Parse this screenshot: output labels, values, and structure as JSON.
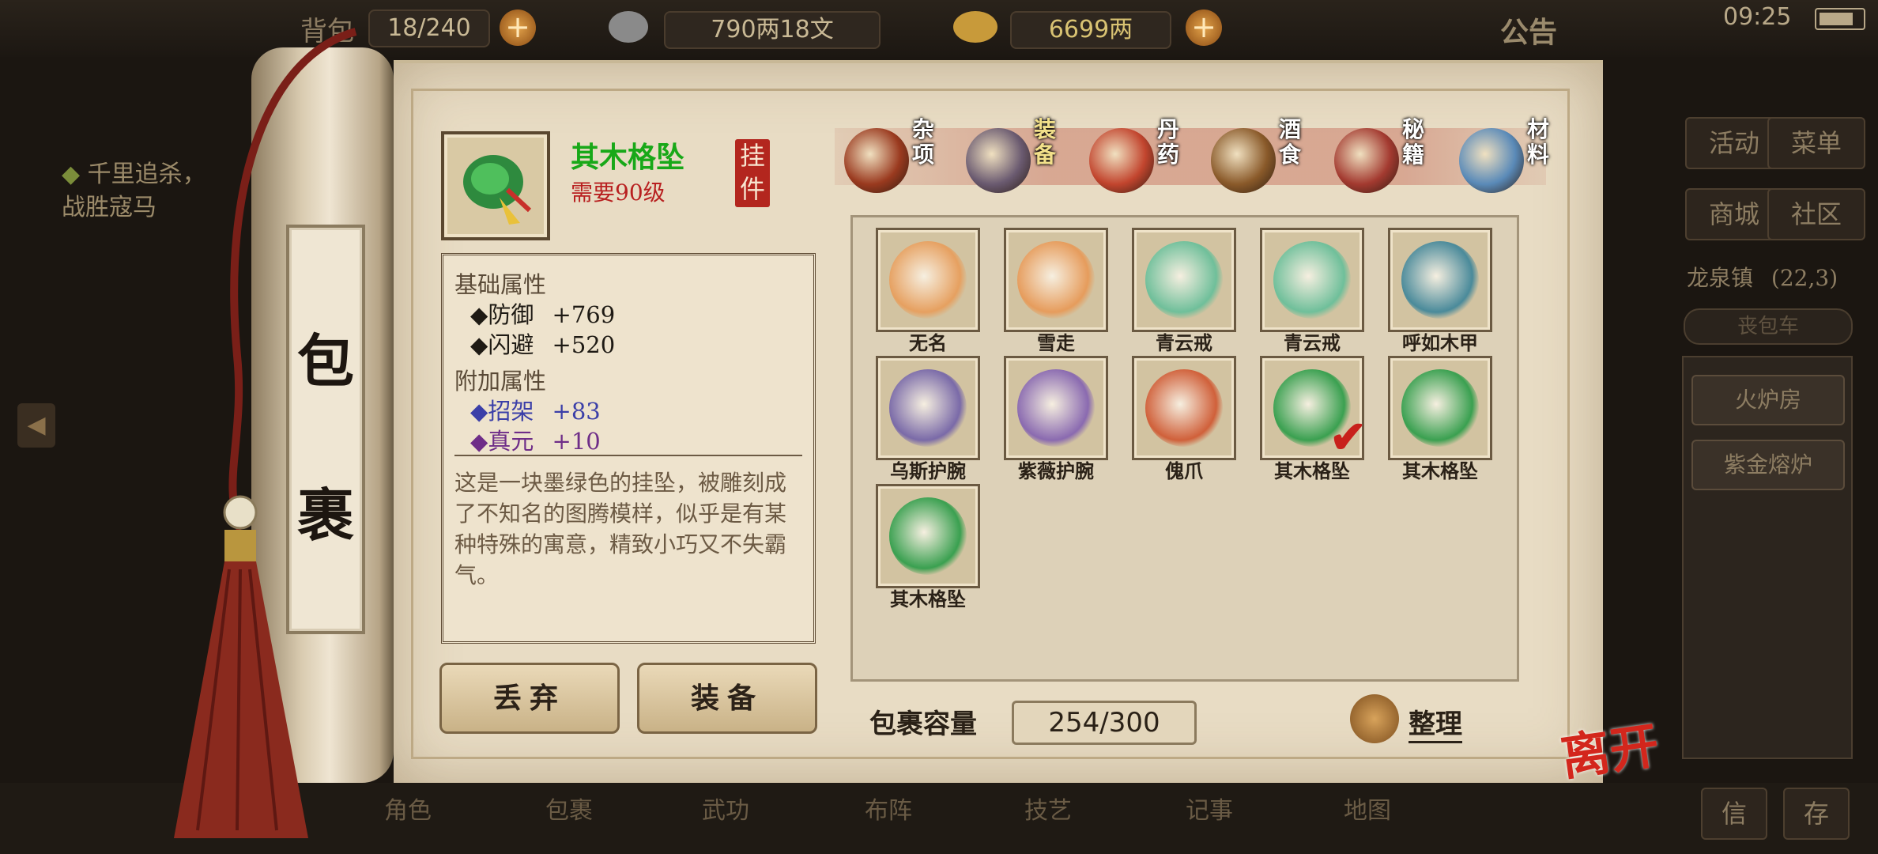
{
  "topbar": {
    "bag_label": "背包",
    "bag_count": "18/240",
    "silver": "790两18文",
    "gold": "6699两",
    "notice": "公告",
    "time": "09:25"
  },
  "quest": {
    "title": "千里追杀，",
    "subtitle": "战胜寇马"
  },
  "scroll_title": [
    "包",
    "裹"
  ],
  "item": {
    "name": "其木格坠",
    "requirement": "需要90级",
    "slot": [
      "挂",
      "件"
    ],
    "base_header": "基础属性",
    "base_attrs": [
      {
        "name": "防御",
        "value": "+769"
      },
      {
        "name": "闪避",
        "value": "+520"
      }
    ],
    "extra_header": "附加属性",
    "extra_attrs": [
      {
        "name": "招架",
        "value": "+83"
      },
      {
        "name": "真元",
        "value": "+10"
      }
    ],
    "description": "这是一块墨绿色的挂坠，被雕刻成了不知名的图腾模样，似乎是有某种特殊的寓意，精致小巧又不失霸气。"
  },
  "buttons": {
    "discard": "丢弃",
    "equip": "装备"
  },
  "tabs": [
    {
      "label": "杂项",
      "icon": "jar-icon",
      "color": "#9a3a1f"
    },
    {
      "label": "装备",
      "icon": "weapons-icon",
      "color": "#6a5a70",
      "active": true
    },
    {
      "label": "丹药",
      "icon": "pills-icon",
      "color": "#c2452e"
    },
    {
      "label": "酒食",
      "icon": "wine-food-icon",
      "color": "#8a5a2a"
    },
    {
      "label": "秘籍",
      "icon": "books-icon",
      "color": "#a33a30"
    },
    {
      "label": "材料",
      "icon": "crystal-icon",
      "color": "#5a8ab8"
    }
  ],
  "grid": [
    {
      "name": "无名",
      "icon": "sword-icon",
      "color": "#e6a060"
    },
    {
      "name": "雪走",
      "icon": "katana-icon",
      "color": "#e69c5c"
    },
    {
      "name": "青云戒",
      "icon": "ring-icon",
      "color": "#6fbf9a"
    },
    {
      "name": "青云戒",
      "icon": "ring-icon",
      "color": "#6fbf9a"
    },
    {
      "name": "呼如木甲",
      "icon": "armor-icon",
      "color": "#4a8a9a"
    },
    {
      "name": "乌斯护腕",
      "icon": "bracer-icon",
      "color": "#7a6aa8"
    },
    {
      "name": "紫薇护腕",
      "icon": "bracer-icon",
      "color": "#8a6ab0"
    },
    {
      "name": "傀爪",
      "icon": "claw-icon",
      "color": "#d0603a"
    },
    {
      "name": "其木格坠",
      "icon": "pendant-icon",
      "color": "#3aa050",
      "equipped": true
    },
    {
      "name": "其木格坠",
      "icon": "pendant-icon",
      "color": "#3aa050"
    },
    {
      "name": "其木格坠",
      "icon": "pendant-icon",
      "color": "#3aa050"
    }
  ],
  "capacity": {
    "label": "包裹容量",
    "value": "254/300"
  },
  "sort_label": "整理",
  "right_panel": {
    "activity": "活动",
    "menu": "菜单",
    "shop": "商城",
    "community": "社区",
    "location": "龙泉镇",
    "coords": "(22,3)",
    "bag_tab": "丧包车",
    "furnace": "火炉房",
    "forge": "紫金熔炉",
    "mail": "信",
    "save": "存"
  },
  "leave": "离开",
  "bottom_nav": [
    "角色",
    "包裹",
    "武功",
    "布阵",
    "技艺",
    "记事",
    "地图"
  ]
}
